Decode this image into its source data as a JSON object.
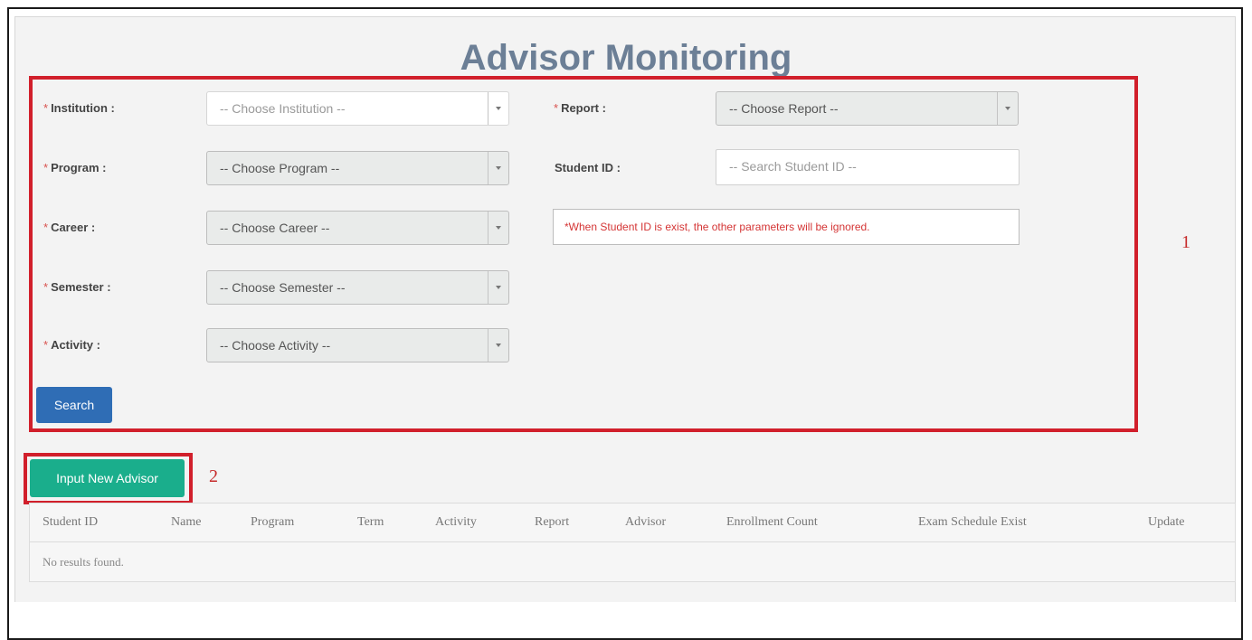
{
  "page": {
    "title": "Advisor Monitoring"
  },
  "form": {
    "institution": {
      "label": "Institution :",
      "placeholder": "-- Choose Institution --"
    },
    "program": {
      "label": "Program :",
      "placeholder": "-- Choose Program --"
    },
    "career": {
      "label": "Career :",
      "placeholder": "-- Choose Career --"
    },
    "semester": {
      "label": "Semester :",
      "placeholder": "-- Choose Semester --"
    },
    "activity": {
      "label": "Activity :",
      "placeholder": "-- Choose Activity --"
    },
    "report": {
      "label": "Report :",
      "placeholder": "-- Choose Report --"
    },
    "student_id": {
      "label": "Student ID :",
      "placeholder": "-- Search Student ID --"
    },
    "note": "*When Student ID is exist, the other parameters will be ignored.",
    "required_mark": "*",
    "search_label": "Search"
  },
  "actions": {
    "input_new_advisor_label": "Input New Advisor"
  },
  "annotations": {
    "box1": "1",
    "box2": "2"
  },
  "table": {
    "columns": [
      "Student ID",
      "Name",
      "Program",
      "Term",
      "Activity",
      "Report",
      "Advisor",
      "Enrollment Count",
      "Exam Schedule Exist",
      "Update"
    ],
    "empty_text": "No results found."
  },
  "colors": {
    "title": "#6c7f96",
    "annotation_red": "#d11f2b",
    "search_button": "#2f6db5",
    "input_button": "#1aae8c",
    "note_text": "#d43535"
  }
}
